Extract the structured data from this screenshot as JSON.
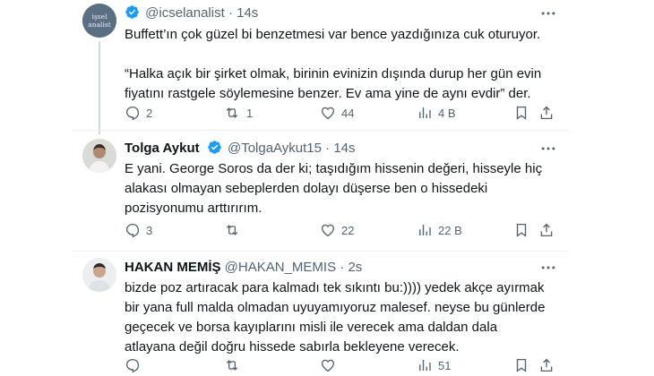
{
  "tweets": [
    {
      "handle": "@icselanalist",
      "time": "14s",
      "avatar_text_line1": "işsel",
      "avatar_text_line2": "analist",
      "paragraph1": "Buffett’ın çok güzel bi benzetmesi var bence yazdığınıza cuk oturuyor.",
      "paragraph2": "“Halka açık bir şirket olmak, birinin evinizin dışında durup her gün evin fiyatını rastgele söylemesine benzer. Ev ama yine de aynı evdir” der.",
      "replies": "2",
      "retweets": "1",
      "likes": "44",
      "views": "4 B"
    },
    {
      "name": "Tolga Aykut",
      "handle": "@TolgaAykut15",
      "time": "14s",
      "paragraph1": "E yani. George Soros da der ki; taşıdığım hissenin değeri, hisseyle hiç alakası olmayan sebeplerden dolayı düşerse ben o hissedeki pozisyonumu arttırırım.",
      "replies": "3",
      "retweets": "",
      "likes": "22",
      "views": "22 B"
    },
    {
      "name": "HAKAN MEMİŞ",
      "handle": "@HAKAN_MEMIS",
      "time": "2s",
      "paragraph1": "bizde poz artıracak para kalmadı tek sıkıntı bu:)))) yedek akçe ayırmak bir yana full malda olmadan uyuyamıyoruz malesef. neyse bu günlerde geçecek ve borsa kayıplarını misli ile verecek ama daldan dala atlayana değil doğru hissede sabırla bekleyene verecek.",
      "replies": "",
      "retweets": "",
      "likes": "",
      "views": "51"
    }
  ],
  "colors": {
    "verified": "#1d9bf0",
    "secondary": "#536471",
    "text": "#0f1419"
  },
  "icons": [
    "reply-icon",
    "retweet-icon",
    "like-icon",
    "views-icon",
    "bookmark-icon",
    "share-icon",
    "more-icon",
    "verified-badge-icon"
  ]
}
